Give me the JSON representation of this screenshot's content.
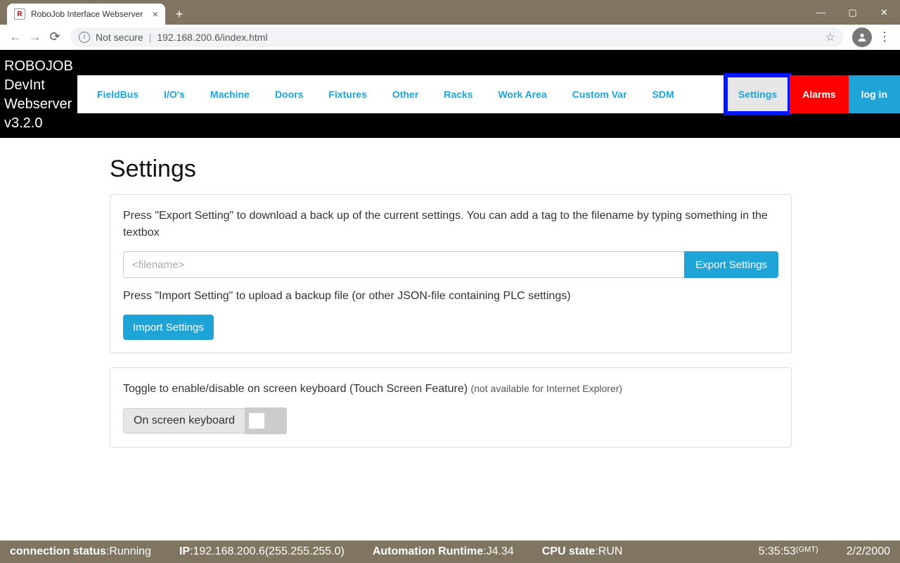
{
  "browser": {
    "tab_title": "RoboJob Interface Webserver",
    "not_secure": "Not secure",
    "url": "192.168.200.6/index.html"
  },
  "header": {
    "logo_line1": "ROBOJOB",
    "logo_line2": "DevInt",
    "logo_line3": "Webserver",
    "logo_line4": "v3.2.0",
    "nav": [
      {
        "label": "FieldBus"
      },
      {
        "label": "I/O's"
      },
      {
        "label": "Machine"
      },
      {
        "label": "Doors"
      },
      {
        "label": "Fixtures"
      },
      {
        "label": "Other"
      },
      {
        "label": "Racks"
      },
      {
        "label": "Work Area"
      },
      {
        "label": "Custom Var"
      },
      {
        "label": "SDM"
      },
      {
        "label": "Settings",
        "active": true,
        "highlight": true
      },
      {
        "label": "Alarms",
        "style": "alarms"
      },
      {
        "label": "log in",
        "style": "login"
      }
    ]
  },
  "page": {
    "title": "Settings",
    "export_desc": "Press \"Export Setting\" to download a back up of the current settings. You can add a tag to the filename by typing something in the textbox",
    "filename_placeholder": "<filename>",
    "export_btn": "Export Settings",
    "import_desc": "Press \"Import Setting\" to upload a backup file (or other JSON-file containing PLC settings)",
    "import_btn": "Import Settings",
    "keyboard_desc_main": "Toggle to enable/disable on screen keyboard (Touch Screen Feature) ",
    "keyboard_desc_note": "(not available for Internet Explorer)",
    "keyboard_toggle_label": "On screen keyboard"
  },
  "status": {
    "conn_label": "connection status",
    "conn_value": ":Running",
    "ip_label": "IP",
    "ip_value": ":192.168.200.6(255.255.255.0)",
    "ar_label": "Automation Runtime",
    "ar_value": ":J4.34",
    "cpu_label": "CPU state",
    "cpu_value": ":RUN",
    "time": "5:35:53",
    "tz": "(GMT)",
    "date": "2/2/2000"
  }
}
